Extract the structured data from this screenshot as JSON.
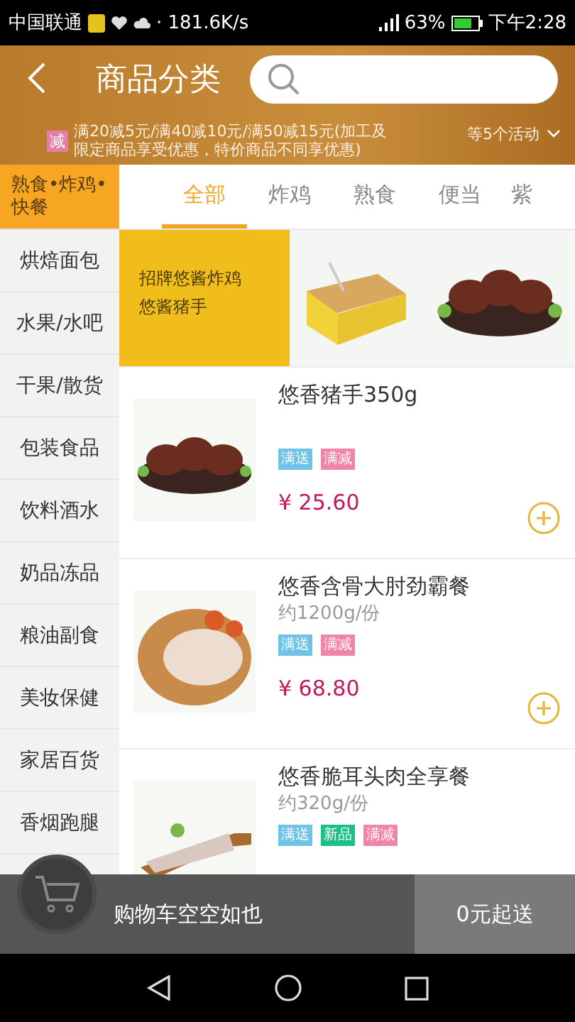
{
  "status_bar": {
    "carrier": "中国联通",
    "speed": "· 181.6K/s",
    "battery": "63%",
    "time": "下午2:28"
  },
  "header": {
    "title": "商品分类",
    "promo": {
      "badge": "减",
      "text": "满20减5元/满40减10元/满50减15元(加工及限定商品享受优惠，特价商品不同享优惠)",
      "more": "等5个活动"
    }
  },
  "sidebar": {
    "items": [
      {
        "label": "熟食•炸鸡•快餐",
        "selected": true
      },
      {
        "label": "烘焙面包",
        "selected": false
      },
      {
        "label": "水果/水吧",
        "selected": false
      },
      {
        "label": "干果/散货",
        "selected": false
      },
      {
        "label": "包装食品",
        "selected": false
      },
      {
        "label": "饮料酒水",
        "selected": false
      },
      {
        "label": "奶品冻品",
        "selected": false
      },
      {
        "label": "粮油副食",
        "selected": false
      },
      {
        "label": "美妆保健",
        "selected": false
      },
      {
        "label": "家居百货",
        "selected": false
      },
      {
        "label": "香烟跑腿",
        "selected": false
      }
    ]
  },
  "tabs": [
    {
      "label": "全部",
      "selected": true
    },
    {
      "label": "炸鸡",
      "selected": false
    },
    {
      "label": "熟食",
      "selected": false
    },
    {
      "label": "便当",
      "selected": false
    },
    {
      "label": "紫",
      "selected": false
    }
  ],
  "banner": {
    "lines": [
      "招牌悠酱炸鸡",
      "悠酱猪手"
    ]
  },
  "products": [
    {
      "name": "悠香猪手350g",
      "tags": [
        {
          "label": "满送",
          "color": "#6ec3e6"
        },
        {
          "label": "满减",
          "color": "#f185a8"
        }
      ],
      "price": "¥ 25.60"
    },
    {
      "name": "悠香含骨大肘劲霸餐",
      "weight": "约1200g/份",
      "tags": [
        {
          "label": "满送",
          "color": "#6ec3e6"
        },
        {
          "label": "满减",
          "color": "#f185a8"
        }
      ],
      "price": "¥ 68.80"
    },
    {
      "name": "悠香脆耳头肉全享餐",
      "weight": "约320g/份",
      "tags": [
        {
          "label": "满送",
          "color": "#6ec3e6"
        },
        {
          "label": "新品",
          "color": "#1cbf86"
        },
        {
          "label": "满减",
          "color": "#f185a8"
        }
      ]
    }
  ],
  "cart": {
    "empty_text": "购物车空空如也",
    "min_order": "0元起送"
  }
}
